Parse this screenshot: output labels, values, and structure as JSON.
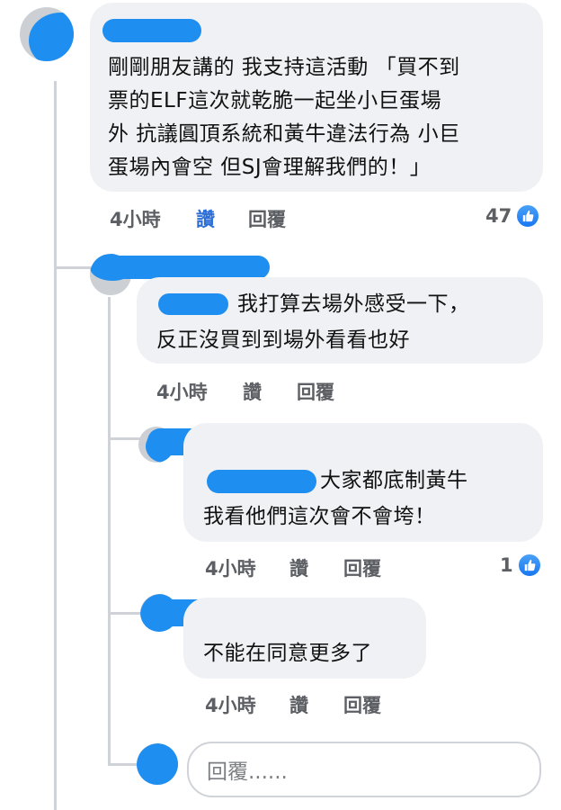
{
  "comments": [
    {
      "body_lines": [
        "剛剛朋友講的 我支持這活動 「買不到",
        "票的ELF這次就乾脆一起坐小巨蛋場",
        "外 抗議圓頂系統和黃牛違法行為 小巨",
        "蛋場內會空 但SJ會理解我們的！」"
      ],
      "time": "4小時",
      "like": "讚",
      "reply": "回覆",
      "reaction_count": "47"
    },
    {
      "body": "我打算去場外感受一下，",
      "body_line2": "反正沒買到到場外看看也好",
      "time": "4小時",
      "like": "讚",
      "reply": "回覆"
    },
    {
      "body": "大家都底制黃牛",
      "body_line2": "我看他們這次會不會垮！",
      "time": "4小時",
      "like": "讚",
      "reply": "回覆",
      "reaction_count": "1"
    },
    {
      "body": "不能在同意更多了",
      "time": "4小時",
      "like": "讚",
      "reply": "回覆"
    }
  ],
  "reply_input": {
    "placeholder": "回覆......"
  },
  "colors": {
    "bubble": "#eff1f4",
    "redaction": "#1f8ef1",
    "like_blue": "#1877f2"
  },
  "icons": {
    "reaction": "thumbs-up-icon"
  }
}
